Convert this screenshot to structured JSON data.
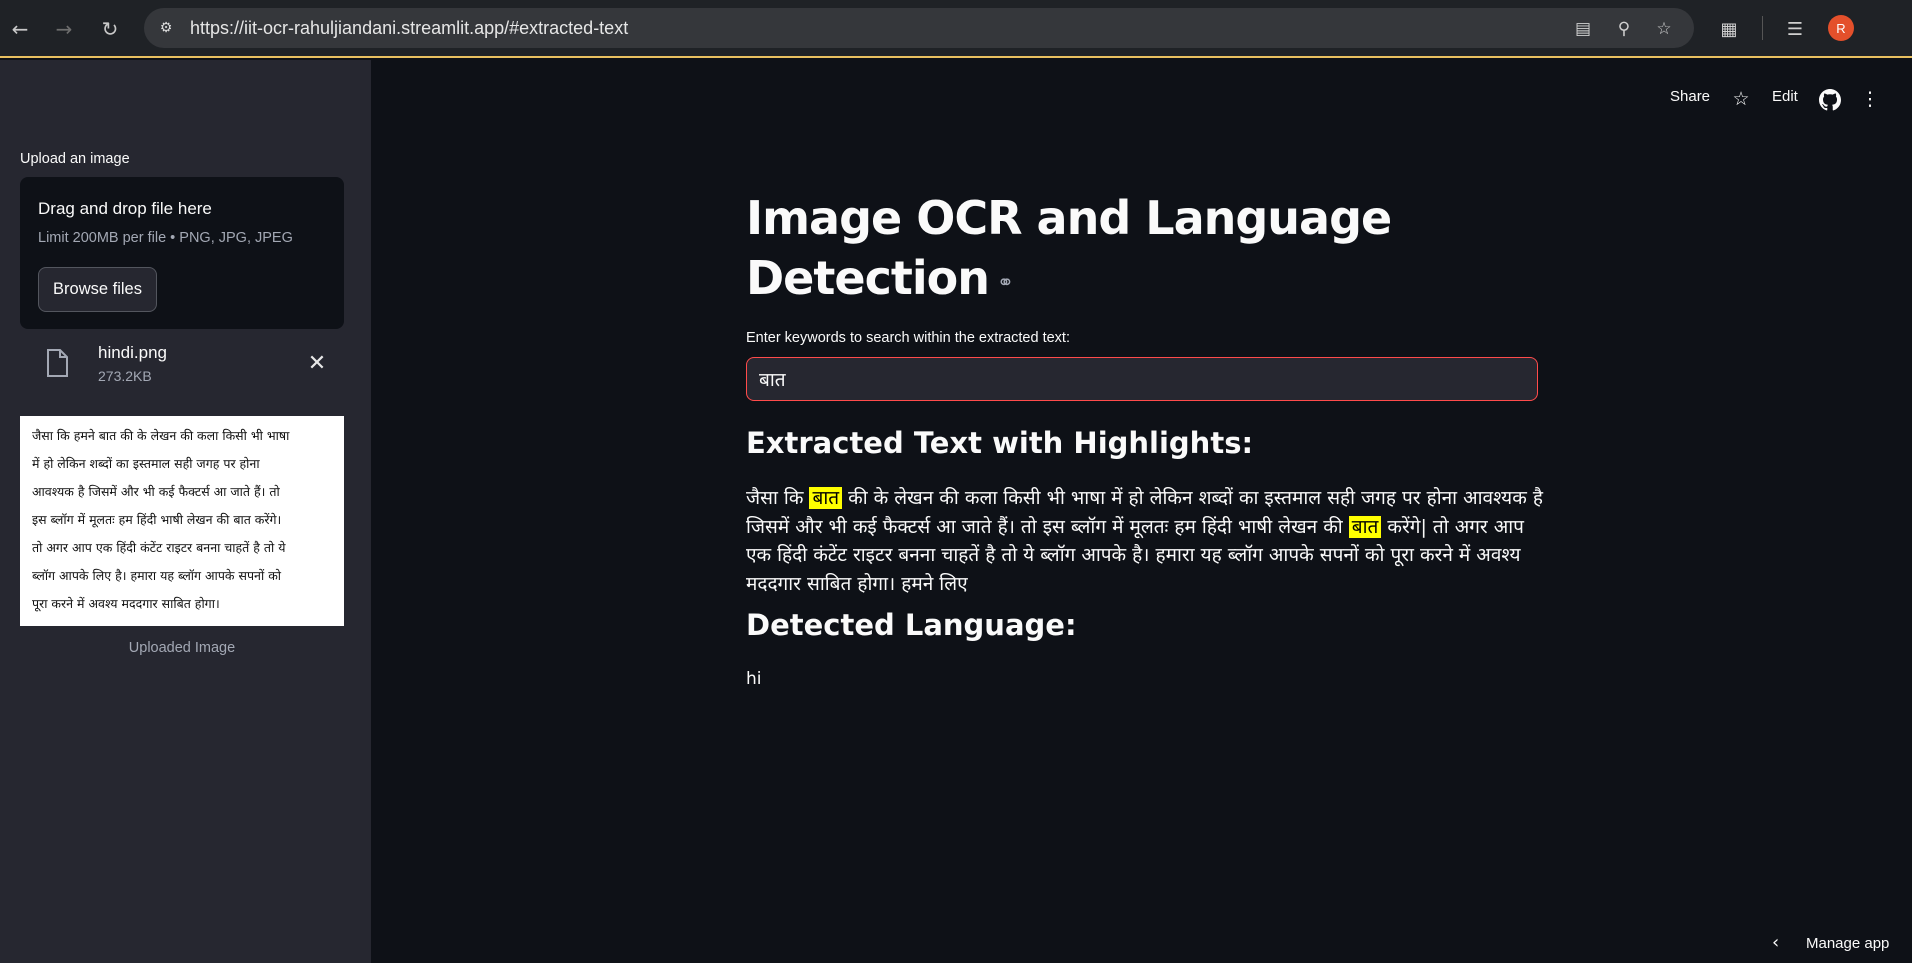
{
  "browser": {
    "url": "https://iit-ocr-rahuljiandani.streamlit.app/#extracted-text",
    "profile_initial": "R",
    "accent_color": "#e4502b"
  },
  "sidebar": {
    "upload_label": "Upload an image",
    "dropzone_title": "Drag and drop file here",
    "dropzone_limit": "Limit 200MB per file • PNG, JPG, JPEG",
    "browse_button": "Browse files",
    "file_name": "hindi.png",
    "file_size": "273.2KB",
    "preview_lines": [
      "जैसा कि हमने बात की के लेखन की कला किसी भी भाषा",
      "में हो लेकिन शब्दों का इस्तमाल सही जगह पर होना",
      "आवश्यक है जिसमें और भी कई फैक्टर्स आ जाते हैं। तो",
      "इस ब्लॉग में मूलतः हम हिंदी भाषी लेखन की बात करेंगे।",
      "तो अगर आप एक हिंदी कंटेंट राइटर बनना चाहतें है तो ये",
      "ब्लॉग आपके लिए है। हमारा यह ब्लॉग आपके सपनों को",
      "पूरा करने में अवश्य मददगार साबित होगा।"
    ],
    "preview_caption": "Uploaded Image"
  },
  "toolbar": {
    "share": "Share",
    "edit": "Edit"
  },
  "main": {
    "title": "Image OCR and Language Detection",
    "search_label": "Enter keywords to search within the extracted text:",
    "search_value": "बात",
    "extracted_heading": "Extracted Text with Highlights:",
    "extracted_parts": [
      {
        "text": "जैसा कि ",
        "highlight": false
      },
      {
        "text": "बात",
        "highlight": true
      },
      {
        "text": " की के लेखन की कला किसी भी भाषा में हो लेकिन शब्दों का इस्तमाल सही जगह पर होना आवश्यक है जिसमें और भी कई फैक्टर्स आ जाते हैं। तो इस ब्लॉग में मूलतः हम हिंदी भाषी लेखन की ",
        "highlight": false
      },
      {
        "text": "बात",
        "highlight": true
      },
      {
        "text": " करेंगे| तो अगर आप एक हिंदी कंटेंट राइटर बनना चाहतें है तो ये ब्लॉग आपके है। हमारा यह ब्लॉग आपके सपनों को पूरा करने में अवश्य मददगार साबित होगा। हमने लिए",
        "highlight": false
      }
    ],
    "highlight_color": "#ffff00",
    "language_heading": "Detected Language:",
    "language_value": "hi"
  },
  "footer": {
    "manage_app": "Manage app"
  }
}
